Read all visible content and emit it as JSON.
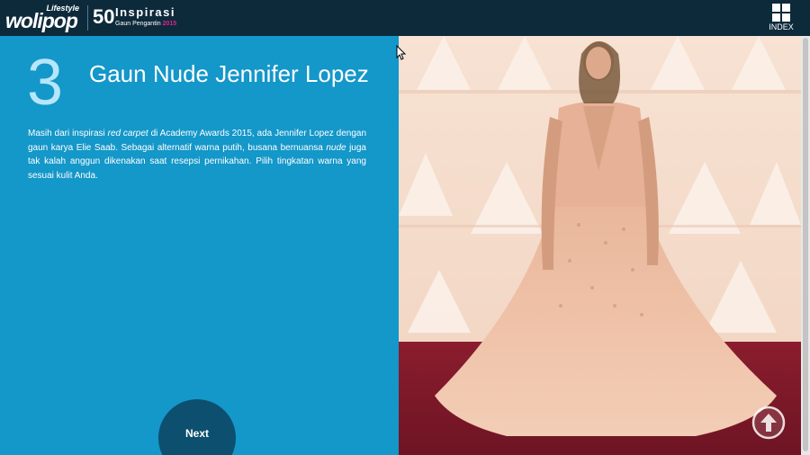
{
  "header": {
    "logo_lifestyle": "Lifestyle",
    "logo_wolipop": "wolipop",
    "brand_number": "50",
    "brand_title": "Inspirasi",
    "brand_subtitle": "Gaun Pengantin",
    "brand_year": "2015",
    "index_label": "INDEX"
  },
  "slide": {
    "number": "3",
    "title": "Gaun Nude Jennifer Lopez",
    "body": {
      "p1": "Masih dari inspirasi ",
      "em1": "red carpet",
      "p2": " di Academy Awards 2015, ada Jennifer Lopez dengan gaun karya Elie Saab. Sebagai alternatif warna putih, busana bernuansa ",
      "em2": "nude",
      "p3": " juga tak kalah anggun dikenakan saat resepsi pernikahan. Pilih tingkatan warna yang sesuai kulit Anda."
    },
    "next_label": "Next"
  },
  "colors": {
    "topbar": "#0d2a3b",
    "panel": "#1497c9",
    "number": "#b6e6fa",
    "next_button": "#0d4f6e",
    "brand_accent": "#e0208c"
  },
  "icons": {
    "index": "grid-icon",
    "scroll_top": "arrow-up-circle-icon"
  }
}
